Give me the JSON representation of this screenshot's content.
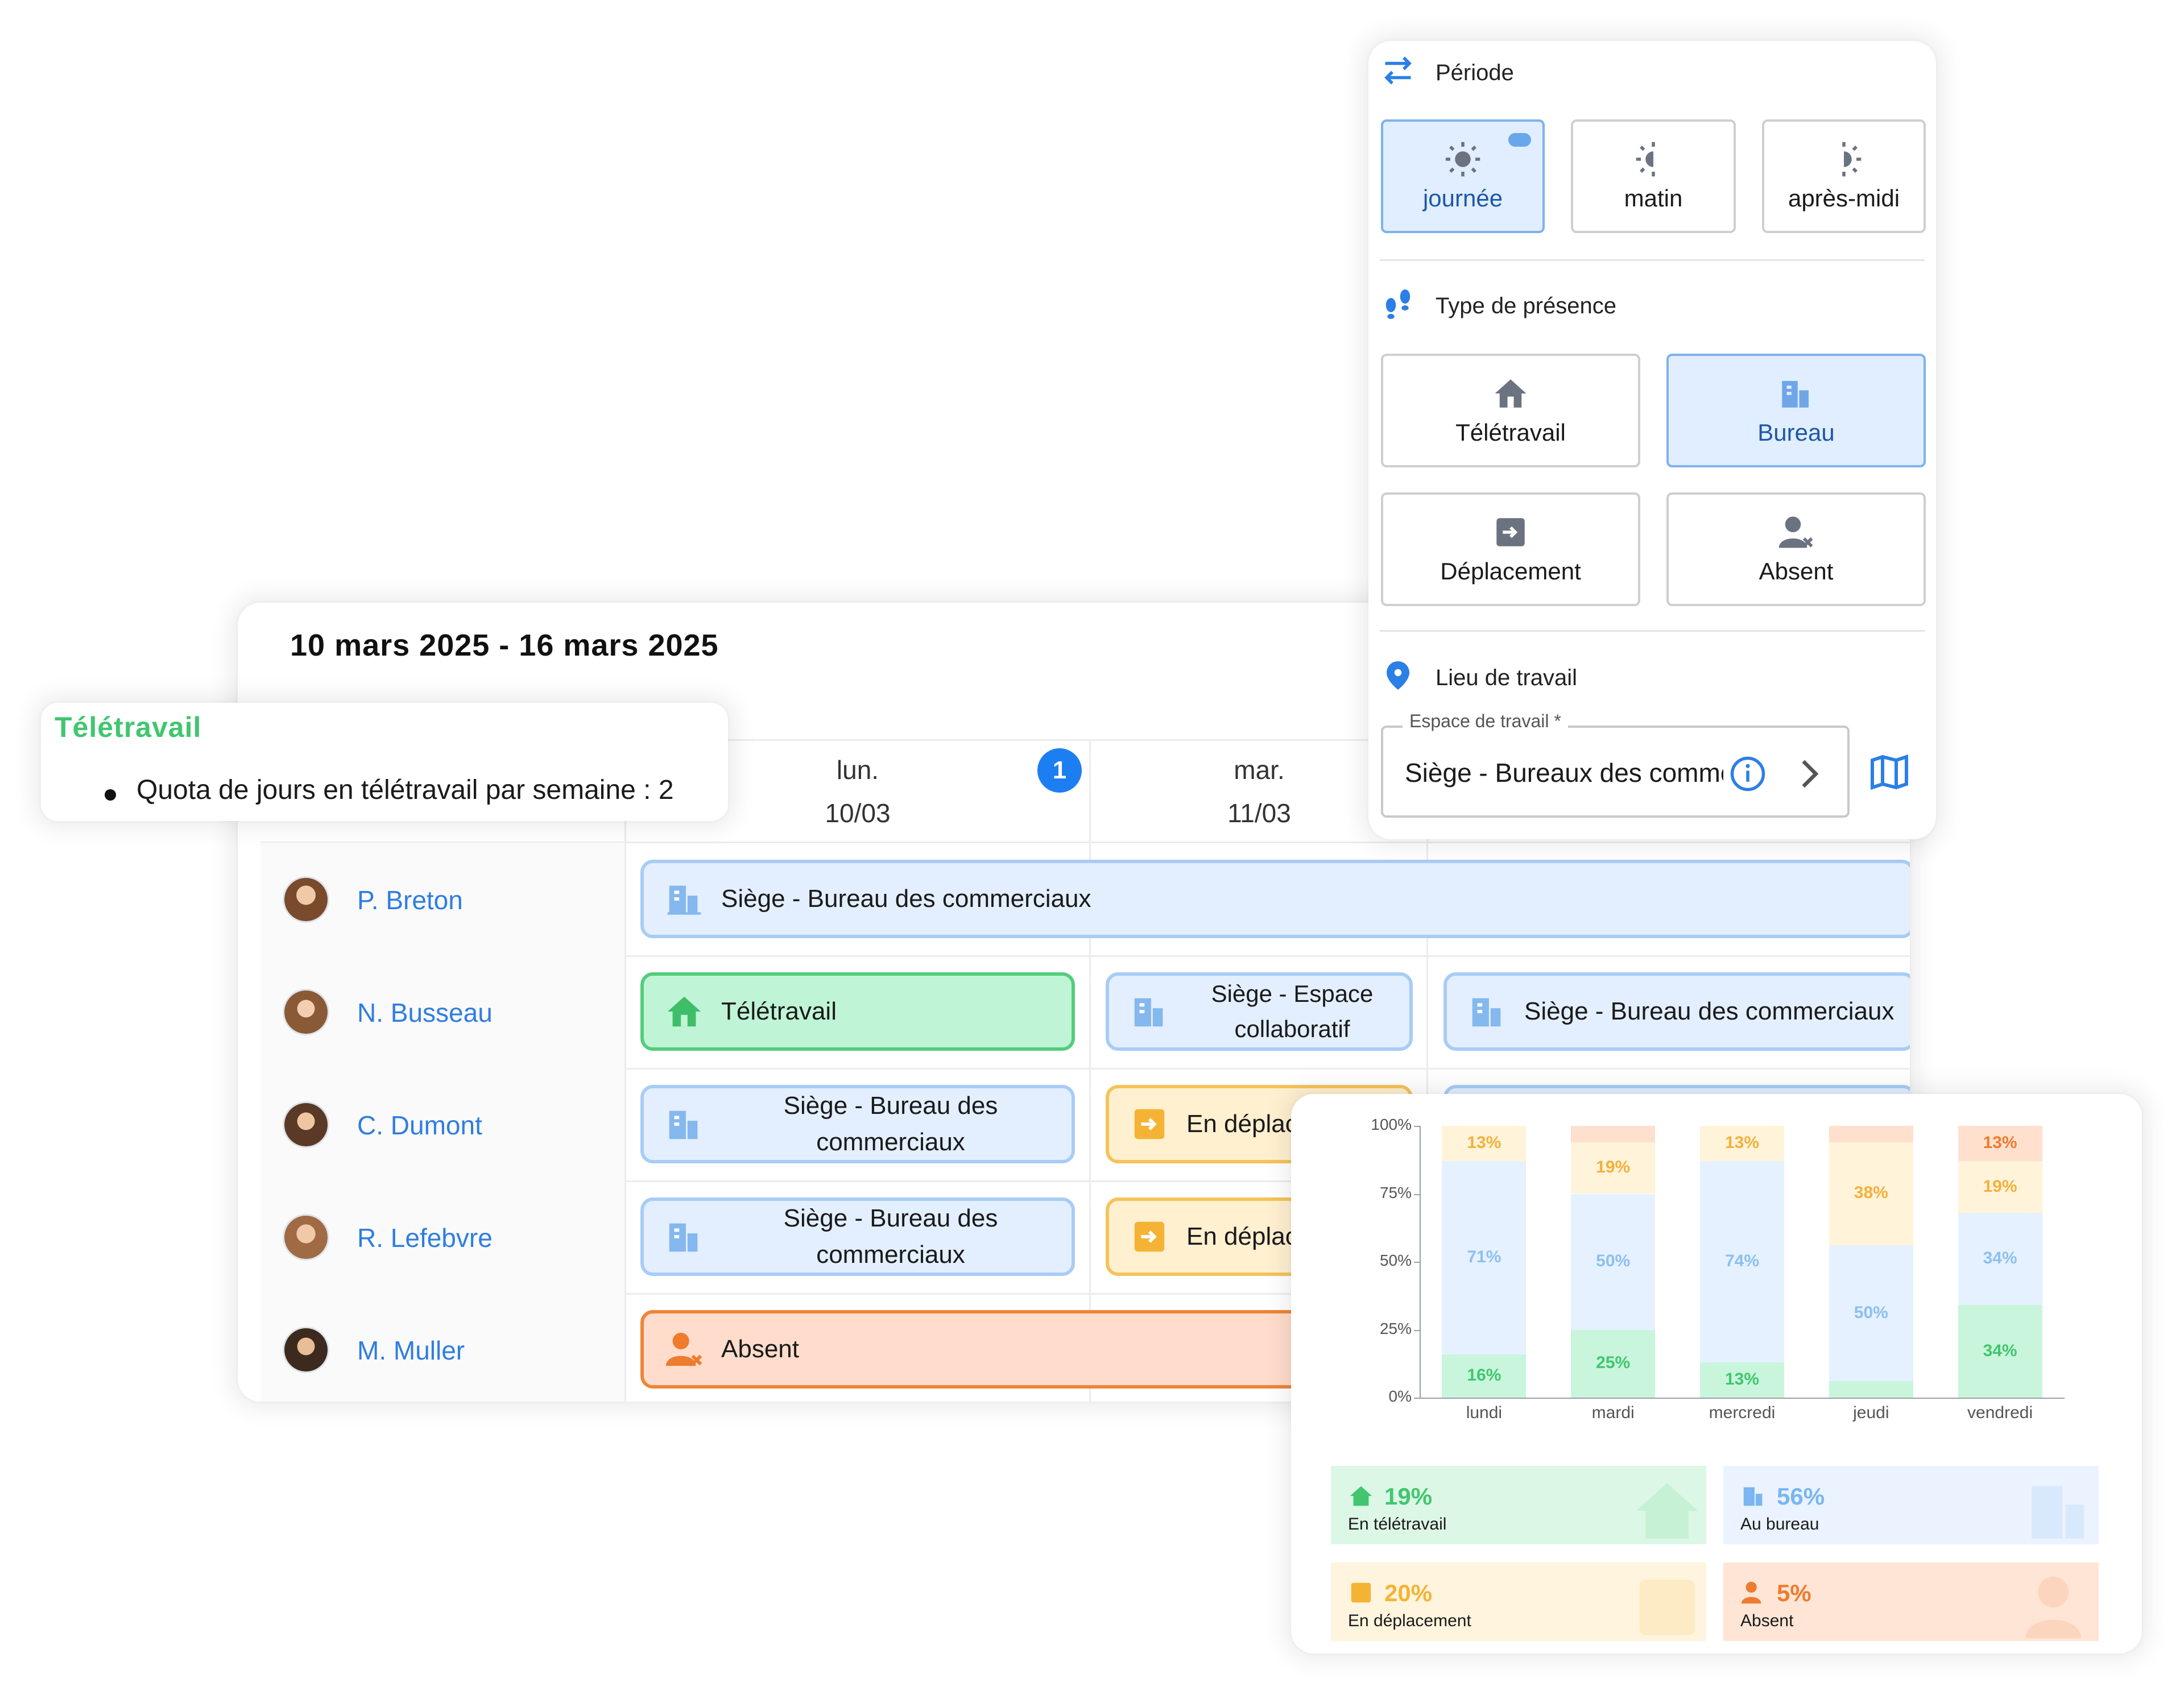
{
  "planning": {
    "week_title": "10 mars 2025 - 16 mars 2025",
    "days": [
      {
        "name": "lun.",
        "date": "10/03",
        "badge": "1"
      },
      {
        "name": "mar.",
        "date": "11/03"
      }
    ],
    "employees": [
      "P. Breton",
      "N. Busseau",
      "C. Dumont",
      "R. Lefebvre",
      "M. Muller"
    ],
    "entries": {
      "breton_1": "Siège - Bureau des commerciaux",
      "busseau_1": "Télétravail",
      "busseau_2": "Siège - Espace collaboratif",
      "busseau_3": "Siège - Bureau des commerciaux",
      "dumont_1": "Siège - Bureau des commerciaux",
      "dumont_2": "En déplacement",
      "lefebvre_1": "Siège - Bureau des commerciaux",
      "lefebvre_2": "En déplacement",
      "muller_1": "Absent"
    }
  },
  "tooltip": {
    "title": "Télétravail",
    "item": "Quota de jours en télétravail par semaine : 2"
  },
  "panel": {
    "periode": {
      "title": "Période",
      "options": [
        "journée",
        "matin",
        "après-midi"
      ],
      "selected": "journée"
    },
    "presence": {
      "title": "Type de présence",
      "options": [
        "Télétravail",
        "Bureau",
        "Déplacement",
        "Absent"
      ],
      "selected": "Bureau"
    },
    "lieu": {
      "title": "Lieu de travail",
      "field_label": "Espace de travail *",
      "field_value": "Siège - Bureaux des commerciaux"
    }
  },
  "colors": {
    "accent": "#1d7ef2",
    "teletravail": "#41c66f",
    "bureau": "#79b6f2",
    "deplacement": "#f5b335",
    "absent": "#ee7b2e"
  },
  "chart_data": {
    "type": "bar",
    "stacked": true,
    "categories": [
      "lundi",
      "mardi",
      "mercredi",
      "jeudi",
      "vendredi"
    ],
    "yticks": [
      "0%",
      "25%",
      "50%",
      "75%",
      "100%"
    ],
    "ylim": [
      0,
      100
    ],
    "series": [
      {
        "values": [
          16,
          25,
          13,
          6,
          34
        ],
        "labels": [
          "16%",
          "25%",
          "13%",
          "",
          "34%"
        ],
        "color": "#c9f5dc",
        "text": "#41c66f"
      },
      {
        "values": [
          71,
          50,
          74,
          50,
          34
        ],
        "labels": [
          "71%",
          "50%",
          "74%",
          "50%",
          "34%"
        ],
        "color": "#e6f1ff",
        "text": "#8cc0f0"
      },
      {
        "values": [
          13,
          19,
          13,
          38,
          19
        ],
        "labels": [
          "13%",
          "19%",
          "13%",
          "38%",
          "19%"
        ],
        "color": "#fff3d9",
        "text": "#f3b13b"
      },
      {
        "values": [
          0,
          6,
          0,
          6,
          13
        ],
        "labels": [
          "",
          "",
          "",
          "",
          "13%"
        ],
        "color": "#ffe0cf",
        "text": "#ee7b2e"
      }
    ],
    "kpis": [
      {
        "value": "19%",
        "label": "En télétravail"
      },
      {
        "value": "56%",
        "label": "Au bureau"
      },
      {
        "value": "20%",
        "label": "En déplacement"
      },
      {
        "value": "5%",
        "label": "Absent"
      }
    ]
  }
}
